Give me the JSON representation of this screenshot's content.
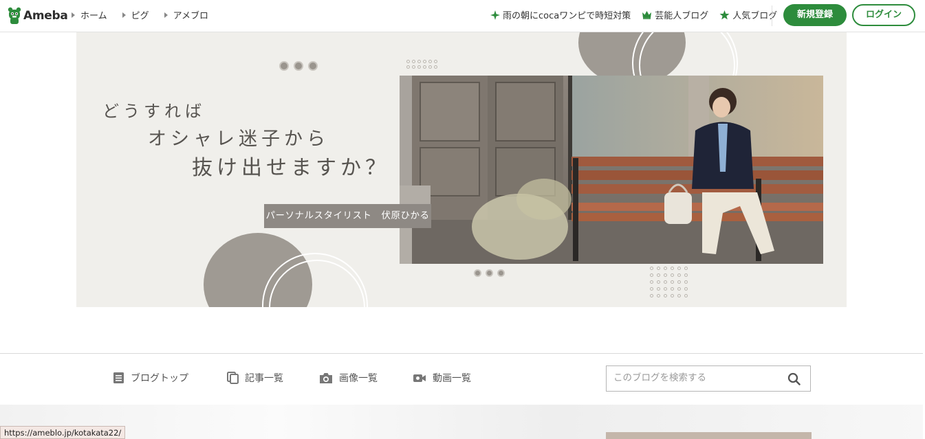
{
  "header": {
    "logo_text": "Ameba",
    "breadcrumbs": [
      {
        "label": "ホーム"
      },
      {
        "label": "ピグ"
      },
      {
        "label": "アメブロ"
      }
    ],
    "right_links": [
      {
        "label": "雨の朝にcocaワンピで時短対策",
        "icon": "sparkle-icon"
      },
      {
        "label": "芸能人ブログ",
        "icon": "crown-icon"
      },
      {
        "label": "人気ブログ",
        "icon": "star-icon"
      }
    ],
    "signup_label": "新規登録",
    "login_label": "ログイン"
  },
  "banner": {
    "catch_lines": [
      "どうすれば",
      "オシャレ迷子から",
      "抜け出せますか？"
    ],
    "caption": "パーソナルスタイリスト　伏原ひかる"
  },
  "blog_nav": {
    "items": [
      {
        "label": "ブログトップ",
        "icon": "document-icon"
      },
      {
        "label": "記事一覧",
        "icon": "copy-icon"
      },
      {
        "label": "画像一覧",
        "icon": "camera-icon"
      },
      {
        "label": "動画一覧",
        "icon": "video-icon"
      }
    ],
    "search_placeholder": "このブログを検索する"
  },
  "status_bar": {
    "url": "https://ameblo.jp/kotakata22/"
  },
  "colors": {
    "brand_green": "#2d8c3c",
    "banner_bg": "#f0efeb",
    "accent_taupe": "#9f9a93"
  }
}
